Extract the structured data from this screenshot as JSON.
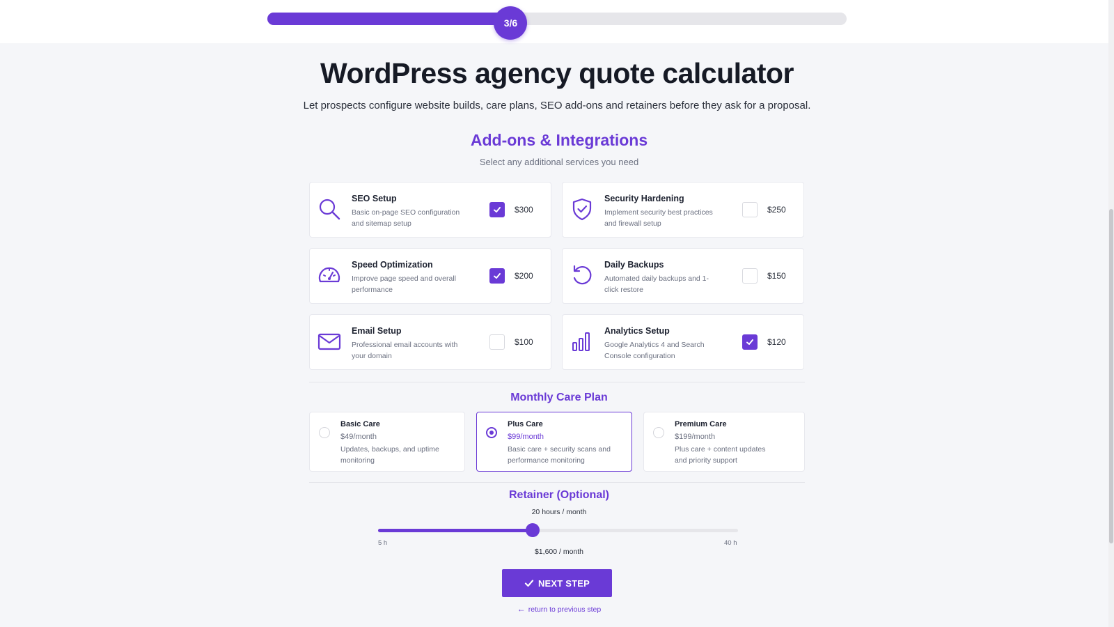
{
  "progress": {
    "label": "3/6",
    "fraction": 0.42
  },
  "header": {
    "title": "WordPress agency quote calculator",
    "subtitle": "Let prospects configure website builds, care plans, SEO add-ons and retainers before they ask for a proposal."
  },
  "addons": {
    "title": "Add-ons & Integrations",
    "subtitle": "Select any additional services you need",
    "items": [
      {
        "name": "SEO Setup",
        "desc": "Basic on-page SEO configuration and sitemap setup",
        "price": "$300",
        "checked": true,
        "icon": "search-icon"
      },
      {
        "name": "Security Hardening",
        "desc": "Implement security best practices and firewall setup",
        "price": "$250",
        "checked": false,
        "icon": "shield-check-icon"
      },
      {
        "name": "Speed Optimization",
        "desc": "Improve page speed and overall performance",
        "price": "$200",
        "checked": true,
        "icon": "speedometer-icon"
      },
      {
        "name": "Daily Backups",
        "desc": "Automated daily backups and 1-click restore",
        "price": "$150",
        "checked": false,
        "icon": "restore-icon"
      },
      {
        "name": "Email Setup",
        "desc": "Professional email accounts with your domain",
        "price": "$100",
        "checked": false,
        "icon": "envelope-icon"
      },
      {
        "name": "Analytics Setup",
        "desc": "Google Analytics 4 and Search Console configuration",
        "price": "$120",
        "checked": true,
        "icon": "bar-chart-icon"
      }
    ]
  },
  "care": {
    "title": "Monthly Care Plan",
    "plans": [
      {
        "name": "Basic Care",
        "price": "$49/month",
        "desc": "Updates, backups, and uptime monitoring",
        "selected": false
      },
      {
        "name": "Plus Care",
        "price": "$99/month",
        "desc": "Basic care + security scans and performance monitoring",
        "selected": true
      },
      {
        "name": "Premium Care",
        "price": "$199/month",
        "desc": "Plus care + content updates and priority support",
        "selected": false
      }
    ]
  },
  "retainer": {
    "title": "Retainer (Optional)",
    "hours_label": "20 hours / month",
    "min_label": "5 h",
    "max_label": "40 h",
    "min": 5,
    "max": 40,
    "value": 20,
    "price_label": "$1,600 / month"
  },
  "actions": {
    "next_label": "NEXT STEP",
    "back_label": "return to previous step"
  },
  "colors": {
    "accent": "#6a3ad6",
    "background": "#f5f6f9",
    "card": "#ffffff"
  }
}
